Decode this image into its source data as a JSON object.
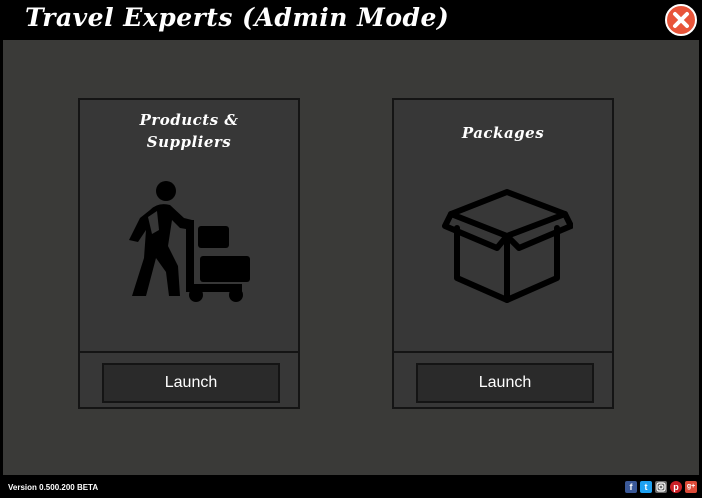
{
  "window": {
    "title": "Travel Experts (Admin Mode)"
  },
  "cards": [
    {
      "title_line1": "Products &",
      "title_line2": "Suppliers",
      "icon": "worker-with-cart-icon",
      "launch_label": "Launch"
    },
    {
      "title": "Packages",
      "icon": "package-box-icon",
      "launch_label": "Launch"
    }
  ],
  "footer": {
    "version": "Version 0.500.200 BETA",
    "social": [
      {
        "name": "facebook-icon",
        "glyph": "f",
        "color": "#3b5998"
      },
      {
        "name": "twitter-icon",
        "glyph": "t",
        "color": "#1da1f2"
      },
      {
        "name": "instagram-icon",
        "glyph": "",
        "color": "#6b6b6b"
      },
      {
        "name": "pinterest-icon",
        "glyph": "p",
        "color": "#cb2027"
      },
      {
        "name": "google-plus-icon",
        "glyph": "g+",
        "color": "#dd4b39"
      }
    ]
  },
  "colors": {
    "background": "#3a3a38",
    "card": "#373737",
    "border": "#141414",
    "button": "#2a2a2a",
    "close_button": "#e8553a"
  }
}
